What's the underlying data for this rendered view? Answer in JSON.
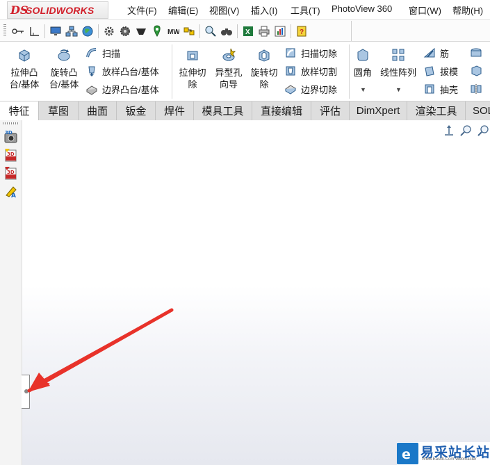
{
  "app": {
    "logo_ds": "DS",
    "logo_text": "SOLIDWORKS"
  },
  "menu": {
    "items": [
      "文件(F)",
      "编辑(E)",
      "视图(V)",
      "插入(I)",
      "工具(T)",
      "PhotoView 360",
      "窗口(W)",
      "帮助(H)"
    ]
  },
  "ribbon": {
    "extrude_boss": "拉伸凸\n台/基体",
    "revolve_boss": "旋转凸\n台/基体",
    "sweep": "扫描",
    "loft_boss": "放样凸台/基体",
    "boundary_boss": "边界凸台/基体",
    "extrude_cut": "拉伸切\n除",
    "hole_wizard": "异型孔\n向导",
    "revolve_cut": "旋转切\n除",
    "swept_cut": "扫描切除",
    "lofted_cut": "放样切割",
    "boundary_cut": "边界切除",
    "fillet": "圆角",
    "linear_pattern": "线性阵列",
    "rib": "筋",
    "draft": "拔模",
    "shell": "抽壳"
  },
  "tabs": [
    "特征",
    "草图",
    "曲面",
    "钣金",
    "焊件",
    "模具工具",
    "直接编辑",
    "评估",
    "DimXpert",
    "渲染工具",
    "SOL"
  ],
  "active_tab": "特征",
  "watermark": {
    "title": "易采站长站",
    "subtitle": "Www.Easck.Com Webmaster"
  },
  "colors": {
    "brand_red": "#d21f2a",
    "arrow_red": "#e8322a",
    "watermark_blue": "#1f5fb0"
  }
}
